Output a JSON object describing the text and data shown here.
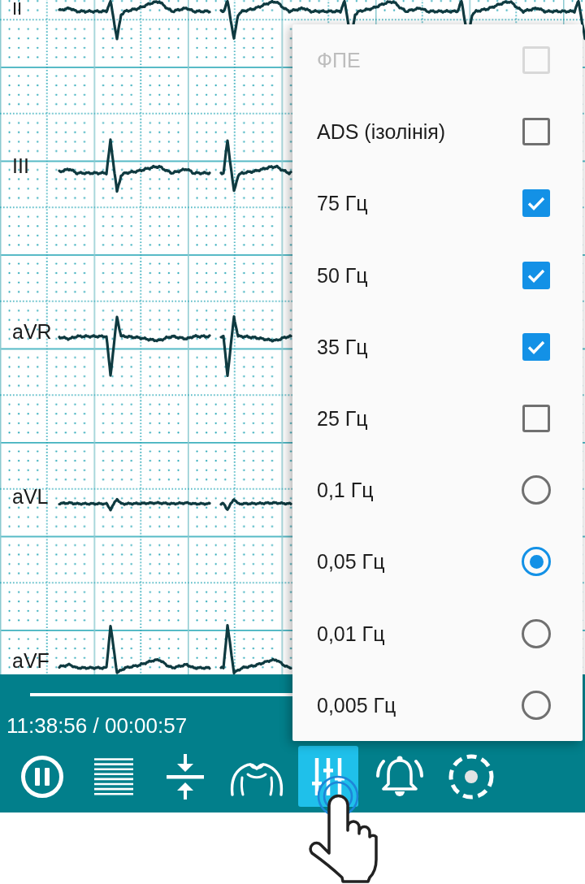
{
  "ecg": {
    "leads": [
      {
        "label": "II"
      },
      {
        "label": "III"
      },
      {
        "label": "aVR"
      },
      {
        "label": "aVL"
      },
      {
        "label": "aVF"
      }
    ]
  },
  "menu": {
    "checkbox_items": [
      {
        "label": "ФПЕ",
        "checked": false,
        "disabled": true
      },
      {
        "label": "ADS (ізолінія)",
        "checked": false,
        "disabled": false
      },
      {
        "label": "75 Гц",
        "checked": true,
        "disabled": false
      },
      {
        "label": "50 Гц",
        "checked": true,
        "disabled": false
      },
      {
        "label": "35 Гц",
        "checked": true,
        "disabled": false
      },
      {
        "label": "25 Гц",
        "checked": false,
        "disabled": false
      }
    ],
    "radio_items": [
      {
        "label": "0,1 Гц",
        "selected": false
      },
      {
        "label": "0,05 Гц",
        "selected": true
      },
      {
        "label": "0,01 Гц",
        "selected": false
      },
      {
        "label": "0,005 Гц",
        "selected": false
      }
    ]
  },
  "playback": {
    "time": "11:38:56 / 00:00:57"
  },
  "toolbar": {
    "buttons": [
      {
        "selected": false
      },
      {
        "selected": false
      },
      {
        "selected": false
      },
      {
        "selected": false
      },
      {
        "selected": true
      },
      {
        "selected": false
      },
      {
        "selected": false
      }
    ]
  }
}
